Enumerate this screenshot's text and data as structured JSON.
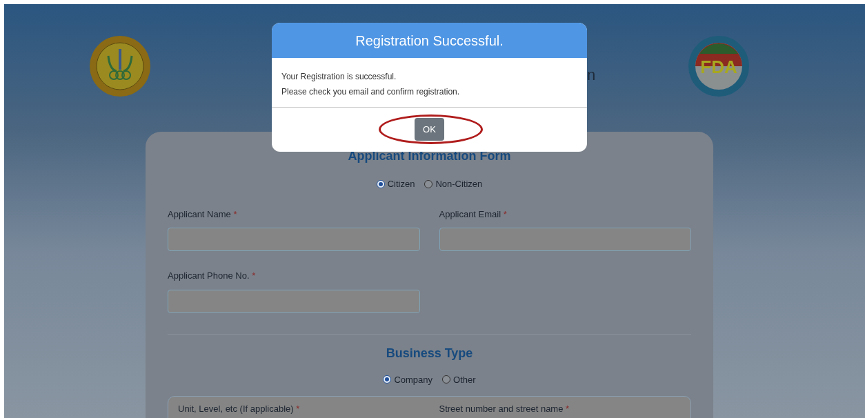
{
  "header": {
    "title_fragment": "n",
    "logo_text": "FDA"
  },
  "form": {
    "title": "Applicant Information Form",
    "citizenship": [
      {
        "label": "Citizen",
        "selected": true
      },
      {
        "label": "Non-Citizen",
        "selected": false
      }
    ],
    "fields": [
      {
        "label": "Applicant Name",
        "required_mark": "*"
      },
      {
        "label": "Applicant Email",
        "required_mark": "*"
      },
      {
        "label": "Applicant Phone No.",
        "required_mark": "*"
      }
    ],
    "business_title": "Business Type",
    "business_type": [
      {
        "label": "Company",
        "selected": true
      },
      {
        "label": "Other",
        "selected": false
      }
    ],
    "address_fields": [
      {
        "label": "Unit, Level, etc (If applicable)",
        "required_mark": "*"
      },
      {
        "label": "Street number and street name",
        "required_mark": "*"
      }
    ]
  },
  "dialog": {
    "title": "Registration Successful.",
    "lines": [
      "Your Registration is successful.",
      "Please check you email and confirm registration."
    ],
    "button": "OK",
    "button_circled": true
  }
}
